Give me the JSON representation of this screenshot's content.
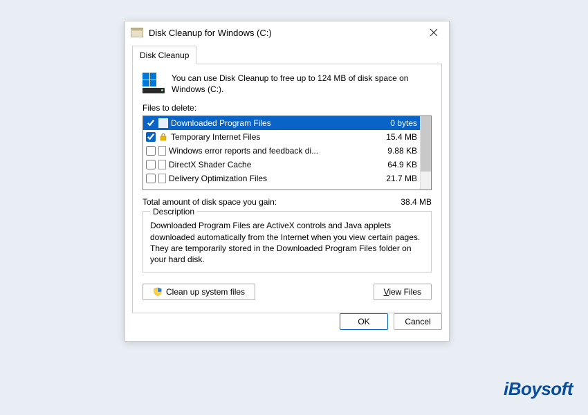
{
  "title": "Disk Cleanup for Windows (C:)",
  "tab": "Disk Cleanup",
  "intro": "You can use Disk Cleanup to free up to 124 MB of disk space on Windows (C:).",
  "files_label": "Files to delete:",
  "files": [
    {
      "label": "Downloaded Program Files",
      "size": "0 bytes",
      "checked": true,
      "icon": "folder",
      "selected": true
    },
    {
      "label": "Temporary Internet Files",
      "size": "15.4 MB",
      "checked": true,
      "icon": "lock",
      "selected": false
    },
    {
      "label": "Windows error reports and feedback di...",
      "size": "9.88 KB",
      "checked": false,
      "icon": "doc",
      "selected": false
    },
    {
      "label": "DirectX Shader Cache",
      "size": "64.9 KB",
      "checked": false,
      "icon": "doc",
      "selected": false
    },
    {
      "label": "Delivery Optimization Files",
      "size": "21.7 MB",
      "checked": false,
      "icon": "doc",
      "selected": false
    }
  ],
  "total_label": "Total amount of disk space you gain:",
  "total_value": "38.4 MB",
  "desc_heading": "Description",
  "desc_text": "Downloaded Program Files are ActiveX controls and Java applets downloaded automatically from the Internet when you view certain pages. They are temporarily stored in the Downloaded Program Files folder on your hard disk.",
  "cleanup_btn": "Clean up system files",
  "view_btn": "View Files",
  "ok": "OK",
  "cancel": "Cancel",
  "watermark": "iBoysoft"
}
